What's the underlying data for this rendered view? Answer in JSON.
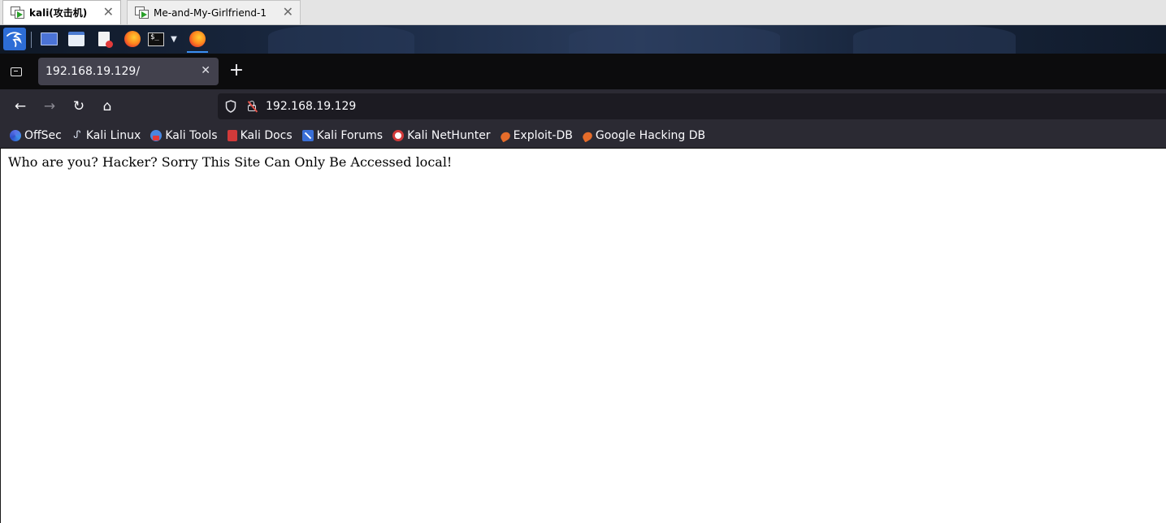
{
  "vmware": {
    "tabs": [
      {
        "label": "kali(攻击机)",
        "active": true
      },
      {
        "label": "Me-and-My-Girlfriend-1",
        "active": false
      }
    ],
    "close_glyph": "✕"
  },
  "kali_panel": {
    "menu_icon": "kali-dragon-icon",
    "launchers": [
      "desktop-icon",
      "files-icon",
      "text-editor-icon",
      "firefox-icon",
      "terminal-icon"
    ],
    "active_app": "firefox-icon",
    "terminal_glyph": "$_"
  },
  "browser": {
    "tab": {
      "title": "192.168.19.129/",
      "close_glyph": "✕"
    },
    "new_tab_glyph": "+",
    "nav": {
      "back": "←",
      "forward": "→",
      "reload": "↻",
      "home": "⌂"
    },
    "url": "192.168.19.129",
    "bookmarks": [
      {
        "label": "OffSec",
        "icon": "offsec-icon"
      },
      {
        "label": "Kali Linux",
        "icon": "kali-linux-icon"
      },
      {
        "label": "Kali Tools",
        "icon": "kali-tools-icon"
      },
      {
        "label": "Kali Docs",
        "icon": "kali-docs-icon"
      },
      {
        "label": "Kali Forums",
        "icon": "kali-forums-icon"
      },
      {
        "label": "Kali NetHunter",
        "icon": "kali-nethunter-icon"
      },
      {
        "label": "Exploit-DB",
        "icon": "exploit-db-icon"
      },
      {
        "label": "Google Hacking DB",
        "icon": "google-hacking-db-icon"
      }
    ]
  },
  "page": {
    "message": "Who are you? Hacker? Sorry This Site Can Only Be Accessed local!"
  },
  "colors": {
    "tab_bar": "#0c0c0d",
    "toolbar": "#2b2a33",
    "urlbar": "#1c1b22",
    "active_tab": "#42414d",
    "kali_blue": "#2d6dd6"
  }
}
